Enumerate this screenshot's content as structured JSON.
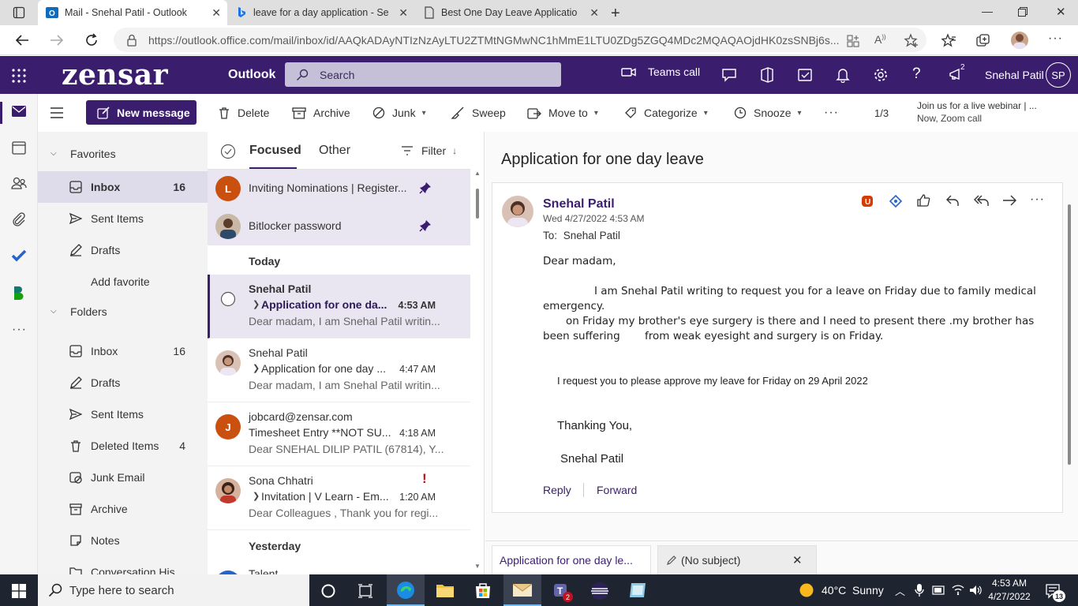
{
  "browser": {
    "tabs": [
      {
        "title": "Mail - Snehal Patil - Outlook",
        "icon": "outlook-icon",
        "active": true
      },
      {
        "title": "leave for a day application - Sear",
        "icon": "bing-icon",
        "active": false
      },
      {
        "title": "Best One Day Leave Application",
        "icon": "page-icon",
        "active": false
      }
    ],
    "url": "https://outlook.office.com/mail/inbox/id/AAQkADAyNTIzNzAyLTU2ZTMtNGMwNC1hMmE1LTU0ZDg5ZGQ4MDc2MQAQAOjdHK0zsSNBj6s..."
  },
  "header": {
    "logo": "zensar",
    "app_name": "Outlook",
    "search_placeholder": "Search",
    "teams_call": "Teams call",
    "notification_badge": "2",
    "user_name": "Snehal Patil",
    "user_initials": "SP",
    "accent": "#3b1d6e"
  },
  "commands": {
    "new_message": "New message",
    "delete": "Delete",
    "archive": "Archive",
    "junk": "Junk",
    "sweep": "Sweep",
    "move_to": "Move to",
    "categorize": "Categorize",
    "snooze": "Snooze",
    "more": "···",
    "pager": "1/3",
    "webinar_title": "Join us for a live webinar | ...",
    "webinar_sub": "Now, Zoom call"
  },
  "folders": {
    "favorites_label": "Favorites",
    "favorites": [
      {
        "label": "Inbox",
        "count": "16",
        "icon": "inbox-icon",
        "selected": true
      },
      {
        "label": "Sent Items",
        "count": "",
        "icon": "send-icon"
      },
      {
        "label": "Drafts",
        "count": "",
        "icon": "pencil-icon"
      }
    ],
    "add_favorite": "Add favorite",
    "folders_label": "Folders",
    "items": [
      {
        "label": "Inbox",
        "count": "16",
        "icon": "inbox-icon"
      },
      {
        "label": "Drafts",
        "count": "",
        "icon": "pencil-icon"
      },
      {
        "label": "Sent Items",
        "count": "",
        "icon": "send-icon"
      },
      {
        "label": "Deleted Items",
        "count": "4",
        "icon": "trash-icon"
      },
      {
        "label": "Junk Email",
        "count": "",
        "icon": "junk-icon"
      },
      {
        "label": "Archive",
        "count": "",
        "icon": "archive-icon"
      },
      {
        "label": "Notes",
        "count": "",
        "icon": "note-icon"
      },
      {
        "label": "Conversation His",
        "count": "",
        "icon": "folder-icon"
      }
    ]
  },
  "list": {
    "tab_focused": "Focused",
    "tab_other": "Other",
    "filter": "Filter",
    "pinned": [
      {
        "avatar": "L",
        "avatar_color": "#ca5010",
        "subject": "Inviting Nominations | Register..."
      },
      {
        "avatar": "",
        "avatar_color": "#7a5c3e",
        "subject": "Bitlocker password"
      }
    ],
    "today_label": "Today",
    "messages": [
      {
        "sender": "Snehal Patil",
        "subject": "Application for one da...",
        "time": "4:53 AM",
        "preview": "Dear madam, I am Snehal Patil writin...",
        "selected": true,
        "unread": true
      },
      {
        "sender": "Snehal Patil",
        "subject": "Application for one day ...",
        "time": "4:47 AM",
        "preview": "Dear madam, I am Snehal Patil writin..."
      },
      {
        "sender": "jobcard@zensar.com",
        "subject": "Timesheet Entry **NOT SU...",
        "time": "4:18 AM",
        "preview": "Dear SNEHAL DILIP PATIL (67814), Y...",
        "avatar": "J",
        "avatar_color": "#ca5010"
      },
      {
        "sender": "Sona Chhatri",
        "subject": "Invitation | V Learn - Em...",
        "time": "1:20 AM",
        "preview": "Dear Colleagues , Thank you for regi...",
        "important": "!"
      }
    ],
    "yesterday_label": "Yesterday",
    "next_sender": "Talent"
  },
  "reading": {
    "subject": "Application for one day leave",
    "from": "Snehal Patil",
    "date": "Wed 4/27/2022 4:53 AM",
    "to_label": "To:",
    "to": "Snehal Patil",
    "greeting": "Dear madam,",
    "para1_line1": "I am Snehal Patil writing to request you for a leave on Friday due to family medical",
    "para1_line2": "emergency.",
    "para2_line1": "on Friday my brother's eye surgery is there and I need to present there .my brother has",
    "para2_line2a": "been suffering",
    "para2_line2b": "from weak eyesight  and surgery is on Friday.",
    "request": "I request you to please approve my leave for Friday on 29 April 2022",
    "thanks": "Thanking You,",
    "signature": "Snehal Patil",
    "reply": "Reply",
    "forward": "Forward",
    "draft_tab1": "Application for one day le...",
    "draft_tab2": "(No subject)"
  },
  "taskbar": {
    "search_placeholder": "Type here to search",
    "weather": "40°C  Sunny",
    "time": "4:53 AM",
    "date": "4/27/2022",
    "teams_badge": "2",
    "notif_count": "13"
  }
}
